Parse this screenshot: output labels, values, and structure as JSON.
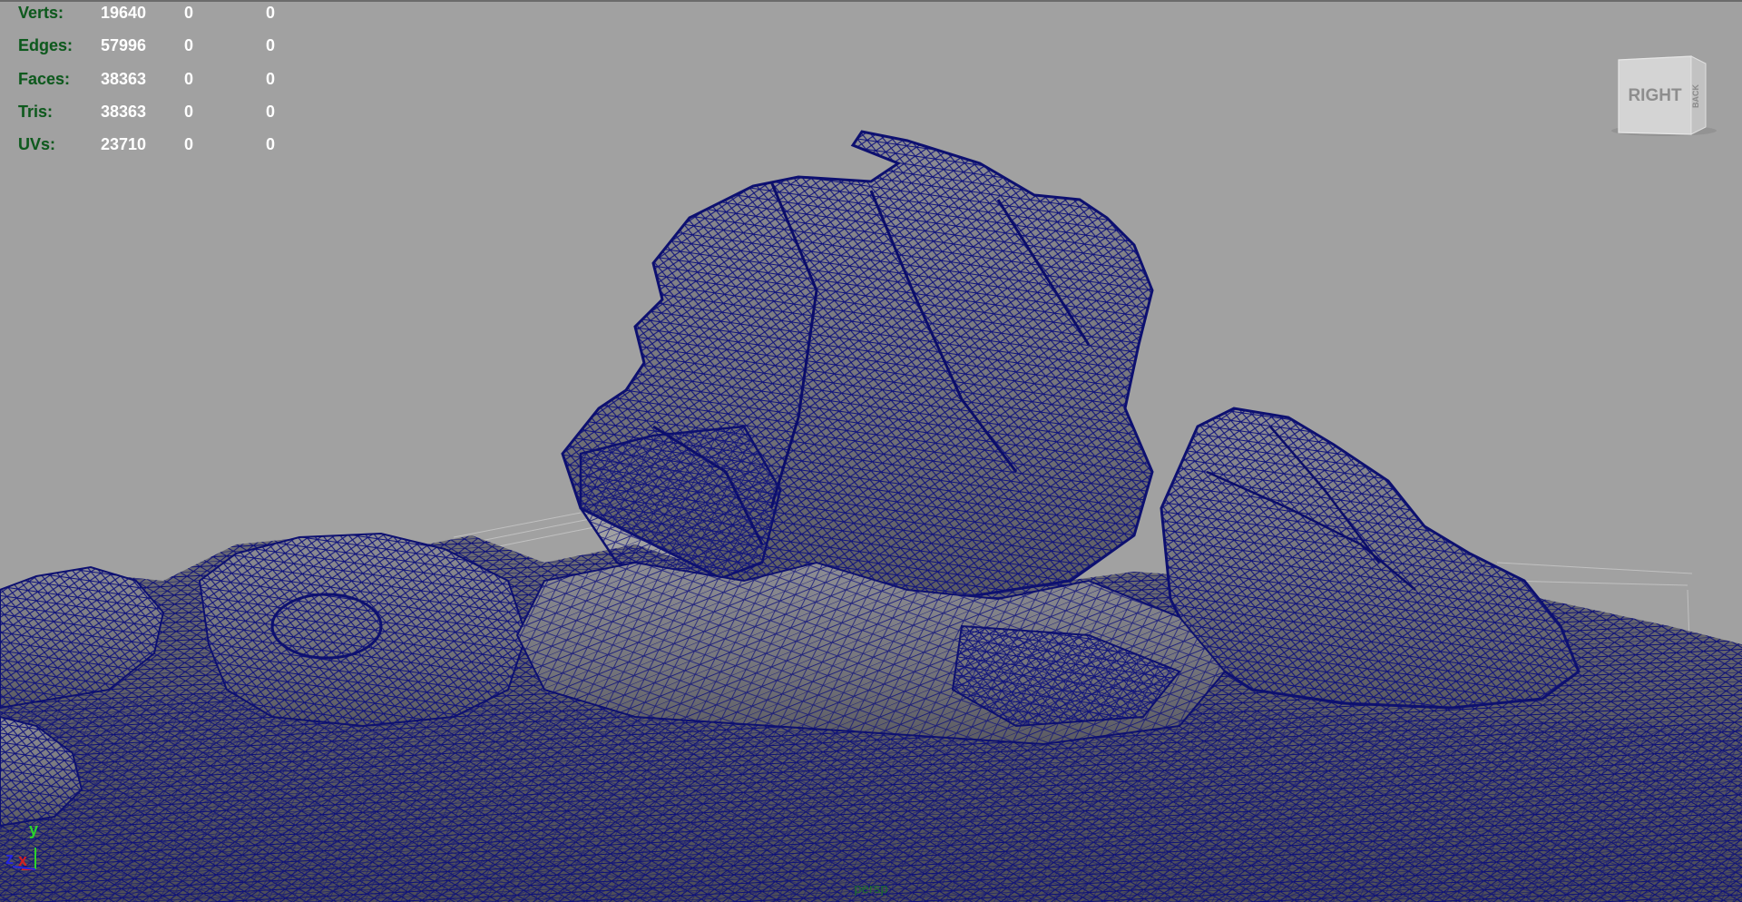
{
  "heads_up_display": {
    "rows": [
      {
        "label": "Verts:",
        "values": [
          "19640",
          "0",
          "0"
        ]
      },
      {
        "label": "Edges:",
        "values": [
          "57996",
          "0",
          "0"
        ]
      },
      {
        "label": "Faces:",
        "values": [
          "38363",
          "0",
          "0"
        ]
      },
      {
        "label": "Tris:",
        "values": [
          "38363",
          "0",
          "0"
        ]
      },
      {
        "label": "UVs:",
        "values": [
          "23710",
          "0",
          "0"
        ]
      }
    ]
  },
  "viewcube": {
    "front_label": "RIGHT",
    "side_label": "BACK"
  },
  "axis_indicator": {
    "y_label": "y",
    "z_label": "z",
    "x_label": "x"
  },
  "camera": {
    "name": "persp"
  },
  "colors": {
    "viewport_background": "#a1a1a1",
    "wireframe": "#0f1180",
    "mesh_shade": "#6d6d6d",
    "hud_label": "#0d5a1d",
    "hud_value": "#ffffff",
    "axis_x": "#d42020",
    "axis_y": "#2bd42b",
    "axis_z": "#2525e0"
  }
}
